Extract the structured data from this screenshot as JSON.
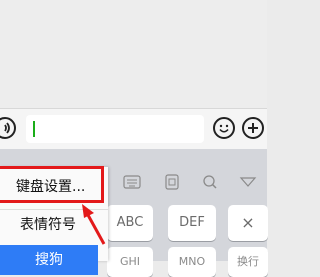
{
  "chat": {
    "background": "#ededed"
  },
  "input_bar": {
    "text_value": "",
    "cursor_color": "#1aad19"
  },
  "keyboard_toolbar": {
    "icons": [
      "keyboard-icon",
      "clipboard-icon",
      "search-icon",
      "collapse-icon"
    ]
  },
  "menu": {
    "items": [
      {
        "label": "键盘设置..."
      },
      {
        "label": "表情符号"
      },
      {
        "label": "搜狗"
      }
    ],
    "selected_color": "#2e7cf6",
    "highlight_color": "#e3191a"
  },
  "keys": {
    "row1": [
      "ABC",
      "DEF",
      "×"
    ],
    "row2": [
      "GHI",
      "MNO",
      "换行"
    ]
  }
}
